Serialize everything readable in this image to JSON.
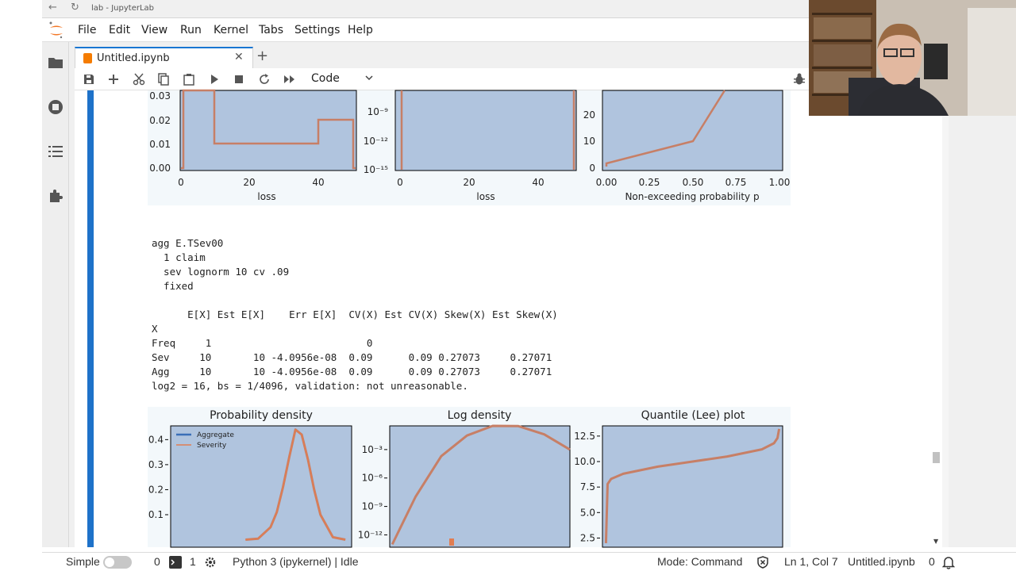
{
  "browser": {
    "title": "lab - JupyterLab"
  },
  "menubar": {
    "items": [
      "File",
      "Edit",
      "View",
      "Run",
      "Kernel",
      "Tabs",
      "Settings",
      "Help"
    ]
  },
  "tab": {
    "label": "Untitled.ipynb",
    "close_glyph": "✕",
    "add_glyph": "+"
  },
  "toolbar": {
    "buttons": [
      "save-icon",
      "add-cell-icon",
      "cut-icon",
      "copy-icon",
      "paste-icon",
      "run-icon",
      "stop-icon",
      "restart-icon",
      "run-all-icon"
    ],
    "cell_type": "Code"
  },
  "figure_top": {
    "panels": [
      {
        "yticks": [
          "0.03",
          "0.02",
          "0.01",
          "0.00"
        ],
        "xticks": [
          "0",
          "20",
          "40"
        ],
        "xlabel": "loss"
      },
      {
        "yticks": [
          "10⁻⁹",
          "10⁻¹²",
          "10⁻¹⁵"
        ],
        "xticks": [
          "0",
          "20",
          "40"
        ],
        "xlabel": "loss"
      },
      {
        "yticks": [
          "20",
          "10",
          "0"
        ],
        "xticks": [
          "0.00",
          "0.25",
          "0.50",
          "0.75",
          "1.00"
        ],
        "xlabel": "Non-exceeding probability p"
      }
    ]
  },
  "output": {
    "lines": [
      "agg E.TSev00",
      "  1 claim",
      "  sev lognorm 10 cv .09",
      "  fixed",
      "",
      "      E[X] Est E[X]    Err E[X]  CV(X) Est CV(X) Skew(X) Est Skew(X)",
      "X",
      "Freq     1                          0",
      "Sev     10       10 -4.0956e-08  0.09      0.09 0.27073     0.27071",
      "Agg     10       10 -4.0956e-08  0.09      0.09 0.27073     0.27071",
      "log2 = 16, bs = 1/4096, validation: not unreasonable."
    ]
  },
  "chart_data": [
    {
      "type": "line",
      "title": "Probability density",
      "yticks": [
        "0.4",
        "0.3",
        "0.2",
        "0.1"
      ],
      "series": [
        {
          "name": "Aggregate",
          "x": [
            6.0,
            7.0,
            8.0,
            8.5,
            9.0,
            9.5,
            10.0,
            10.5,
            11.0,
            11.5,
            12.0,
            13.0,
            14.0
          ],
          "y": [
            0.0,
            0.004,
            0.05,
            0.11,
            0.21,
            0.33,
            0.44,
            0.42,
            0.32,
            0.2,
            0.1,
            0.01,
            0.0
          ]
        },
        {
          "name": "Severity",
          "x": [
            6.0,
            7.0,
            8.0,
            8.5,
            9.0,
            9.5,
            10.0,
            10.5,
            11.0,
            11.5,
            12.0,
            13.0,
            14.0
          ],
          "y": [
            0.0,
            0.004,
            0.05,
            0.11,
            0.21,
            0.33,
            0.44,
            0.42,
            0.32,
            0.2,
            0.1,
            0.01,
            0.0
          ]
        }
      ],
      "legend": "top-left",
      "colors": {
        "aggregate": "#3a6fb8",
        "severity": "#e07d52",
        "plot_bg": "#b0c4de"
      }
    },
    {
      "type": "line",
      "title": "Log density",
      "yscale": "log",
      "yticks": [
        "10⁻³",
        "10⁻⁶",
        "10⁻⁹",
        "10⁻¹²"
      ],
      "series": [
        {
          "name": "Aggregate",
          "x": [
            6.1,
            7.0,
            8.0,
            9.0,
            10.0,
            11.0,
            12.0,
            13.0
          ],
          "y": [
            1e-13,
            1e-08,
            0.0002,
            0.03,
            0.4,
            0.3,
            0.04,
            0.001
          ]
        }
      ]
    },
    {
      "type": "line",
      "title": "Quantile (Lee) plot",
      "yticks": [
        "12.5",
        "10.0",
        "7.5",
        "5.0",
        "2.5"
      ],
      "series": [
        {
          "name": "Aggregate",
          "x": [
            0.0,
            0.01,
            0.03,
            0.1,
            0.3,
            0.5,
            0.7,
            0.9,
            0.97,
            0.99,
            1.0
          ],
          "y": [
            2.0,
            7.8,
            8.3,
            8.8,
            9.5,
            10.0,
            10.5,
            11.2,
            11.8,
            12.3,
            13.2
          ]
        }
      ]
    }
  ],
  "statusbar": {
    "mode_label": "Simple",
    "terminals": "0",
    "kernels": "1",
    "kernel_status": "Python 3 (ipykernel) | Idle",
    "mode": "Mode: Command",
    "position": "Ln 1, Col 7",
    "filename": "Untitled.ipynb",
    "notifications": "0"
  }
}
